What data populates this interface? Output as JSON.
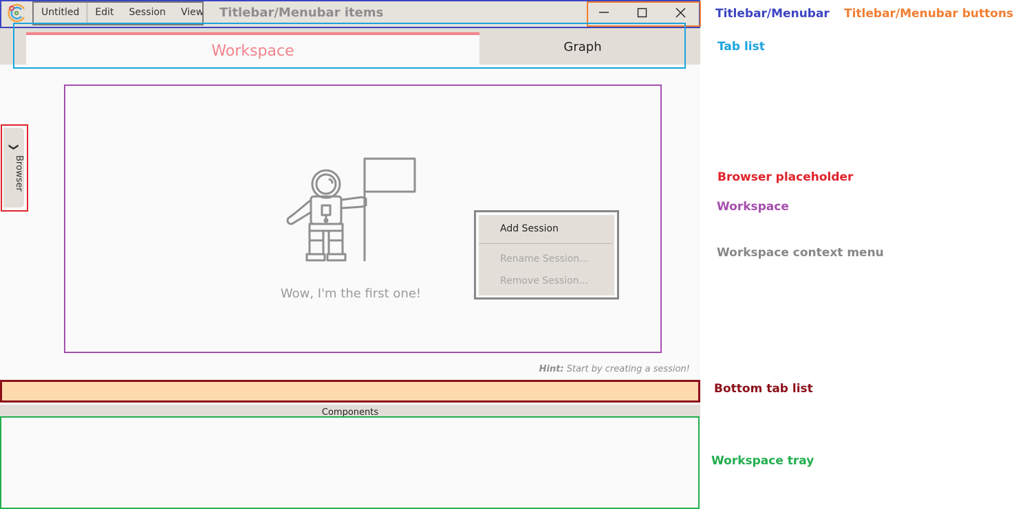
{
  "menubar": {
    "items": [
      "Untitled",
      "Edit",
      "Session",
      "View"
    ],
    "overlay_label": "Titlebar/Menubar items"
  },
  "window_buttons": [
    "minimize-icon",
    "maximize-icon",
    "close-icon"
  ],
  "tabs": [
    {
      "label": "Workspace",
      "active": true
    },
    {
      "label": "Graph",
      "active": false
    }
  ],
  "browser": {
    "label": "Browser",
    "icon": "chevron-right-icon"
  },
  "workspace": {
    "empty_text": "Wow, I'm the first one!",
    "illustration": "astronaut-flag-illustration"
  },
  "context_menu": {
    "items": [
      {
        "label": "Add Session",
        "enabled": true
      },
      {
        "label": "Rename Session...",
        "enabled": false
      },
      {
        "label": "Remove Session...",
        "enabled": false
      }
    ]
  },
  "hint": {
    "prefix": "Hint:",
    "text": " Start by creating a session!"
  },
  "components": {
    "label": "Components"
  },
  "legend": {
    "titlebar": "Titlebar/Menubar",
    "titlebar_buttons": "Titlebar/Menubar buttons",
    "tab_list": "Tab list",
    "browser_placeholder": "Browser placeholder",
    "workspace": "Workspace",
    "context_menu": "Workspace context menu",
    "bottom_tab_list": "Bottom tab list",
    "workspace_tray": "Workspace tray"
  },
  "colors": {
    "titlebar_annotation": "#3c44c1",
    "buttons_annotation": "#f17e31",
    "tablist_annotation": "#1ca3df",
    "browser_annotation": "#e0232b",
    "workspace_annotation": "#a44fae",
    "context_annotation": "#878787",
    "bottomtabs_annotation": "#8c0f19",
    "tray_annotation": "#22ae4e",
    "active_tab_accent": "#f2848c"
  }
}
